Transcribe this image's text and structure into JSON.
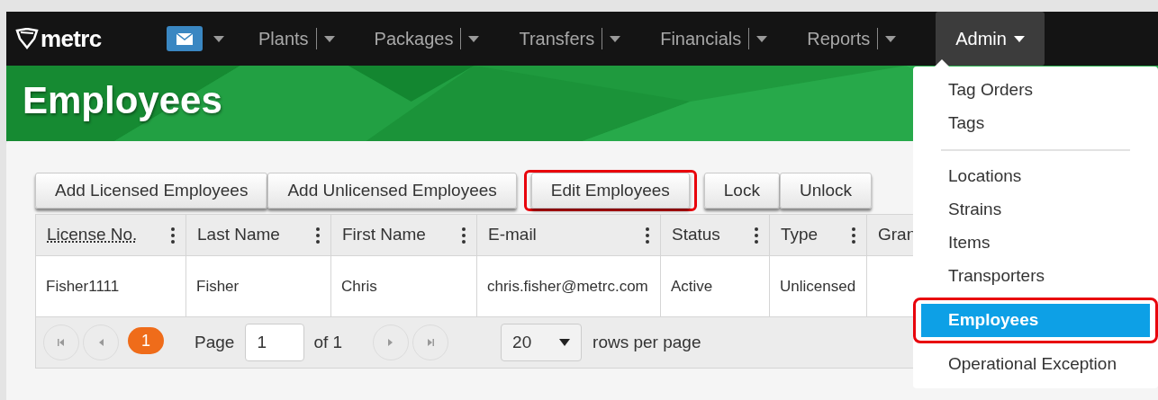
{
  "navbar": {
    "logo": "metrc",
    "items": [
      {
        "label": "Plants",
        "selected": false
      },
      {
        "label": "Packages",
        "selected": false
      },
      {
        "label": "Transfers",
        "selected": false
      },
      {
        "label": "Financials",
        "selected": false
      },
      {
        "label": "Reports",
        "selected": false
      },
      {
        "label": "Admin",
        "selected": true
      }
    ]
  },
  "page_title": "Employees",
  "toolbar_groups": [
    [
      {
        "label": "Add Licensed Employees",
        "highlighted": false
      },
      {
        "label": "Add Unlicensed Employees",
        "highlighted": false
      }
    ],
    [
      {
        "label": "Edit Employees",
        "highlighted": true
      }
    ],
    [
      {
        "label": "Lock",
        "highlighted": false
      },
      {
        "label": "Unlock",
        "highlighted": false
      }
    ]
  ],
  "table": {
    "columns": [
      "License No.",
      "Last Name",
      "First Name",
      "E-mail",
      "Status",
      "Type",
      "Gran"
    ],
    "rows": [
      [
        "Fisher1111",
        "Fisher",
        "Chris",
        "chris.fisher@metrc.com",
        "Active",
        "Unlicensed",
        ""
      ]
    ]
  },
  "pager": {
    "current_page": "1",
    "page_label": "Page",
    "page_value": "1",
    "of_label": "of 1",
    "page_size": "20",
    "page_size_label": "rows per page"
  },
  "admin_menu": [
    {
      "kind": "item",
      "label": "Tag Orders",
      "selected": false,
      "highlighted": false
    },
    {
      "kind": "item",
      "label": "Tags",
      "selected": false,
      "highlighted": false
    },
    {
      "kind": "divider"
    },
    {
      "kind": "item",
      "label": "Locations",
      "selected": false,
      "highlighted": false
    },
    {
      "kind": "item",
      "label": "Strains",
      "selected": false,
      "highlighted": false
    },
    {
      "kind": "item",
      "label": "Items",
      "selected": false,
      "highlighted": false
    },
    {
      "kind": "item",
      "label": "Transporters",
      "selected": false,
      "highlighted": false
    },
    {
      "kind": "item",
      "label": "Employees",
      "selected": true,
      "highlighted": true
    },
    {
      "kind": "item",
      "label": "Operational Exception",
      "selected": false,
      "highlighted": false
    }
  ]
}
